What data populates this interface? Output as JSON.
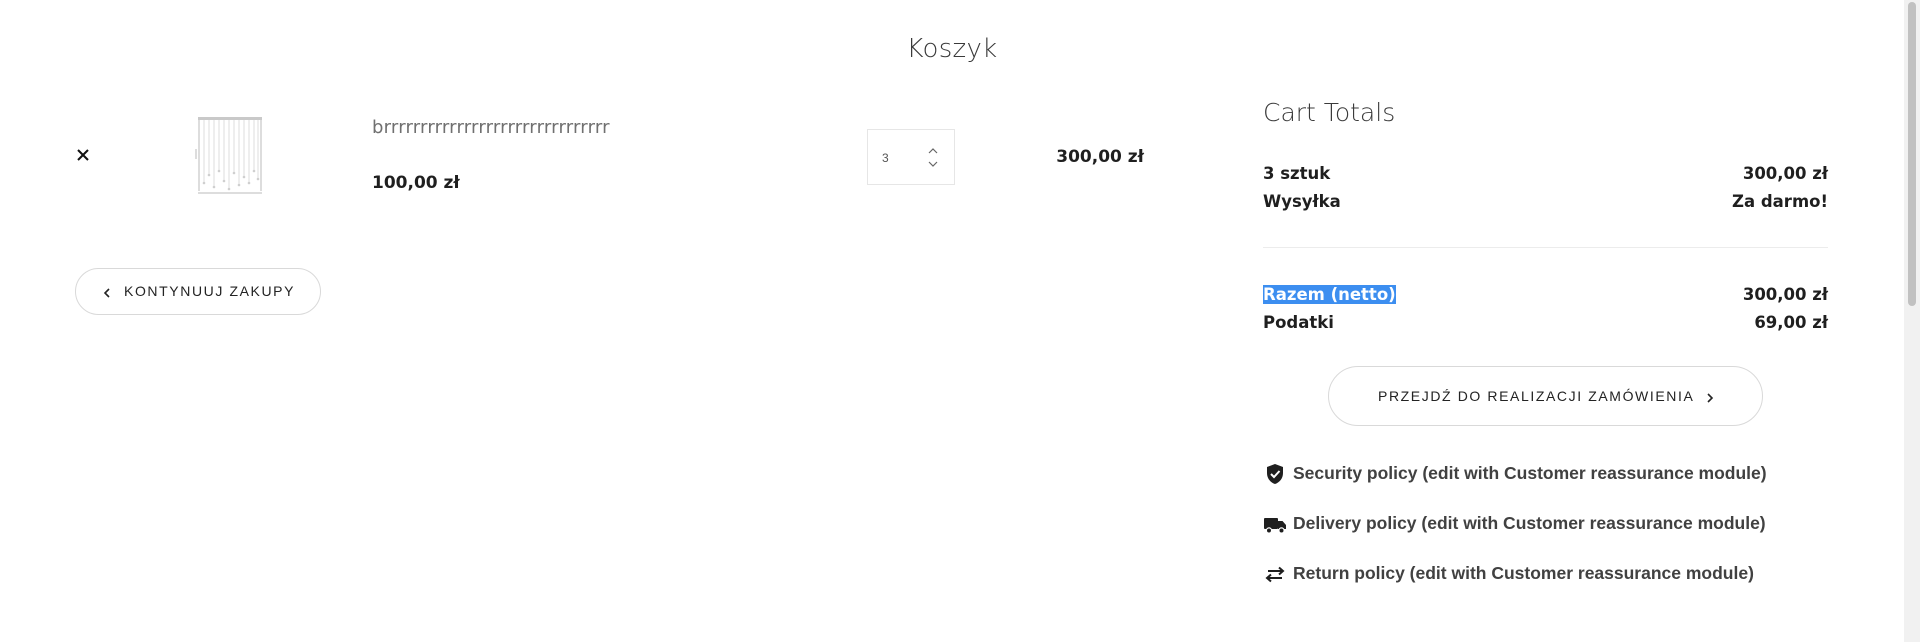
{
  "page": {
    "title": "Koszyk"
  },
  "cart_item": {
    "name": "brrrrrrrrrrrrrrrrrrrrrrrrrrrrrrr",
    "unit_price": "100,00 zł",
    "quantity": "3",
    "line_total": "300,00 zł",
    "image_icon": "pendant-lamp-thumbnail"
  },
  "continue_button": {
    "label": "KONTYNUUJ ZAKUPY"
  },
  "totals": {
    "title": "Cart Totals",
    "items_label": "3 sztuk",
    "items_value": "300,00 zł",
    "shipping_label": "Wysyłka",
    "shipping_value": "Za darmo!",
    "net_label": "Razem (netto)",
    "net_value": "300,00 zł",
    "tax_label": "Podatki",
    "tax_value": "69,00 zł"
  },
  "checkout_button": {
    "label": "PRZEJDŹ DO REALIZACJI ZAMÓWIENIA"
  },
  "reassurance": [
    {
      "icon": "shield-check-icon",
      "text": "Security policy (edit with Customer reassurance module)"
    },
    {
      "icon": "truck-icon",
      "text": "Delivery policy (edit with Customer reassurance module)"
    },
    {
      "icon": "swap-arrows-icon",
      "text": "Return policy (edit with Customer reassurance module)"
    }
  ],
  "colors": {
    "selection_highlight": "#3c8ef0",
    "text_dark": "#1f1f1f",
    "border": "#d9d9d9"
  }
}
